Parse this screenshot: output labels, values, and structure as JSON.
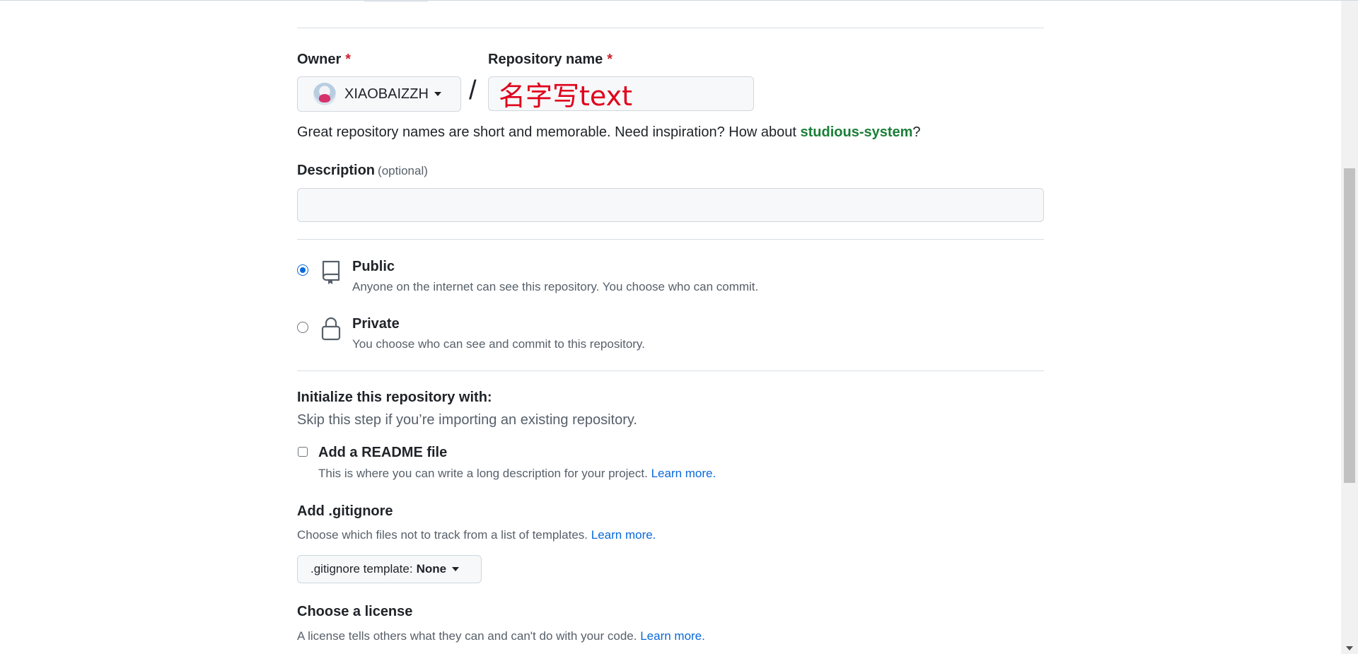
{
  "owner": {
    "label": "Owner",
    "required_mark": "*",
    "value": "XIAOBAIZZH"
  },
  "repository": {
    "label": "Repository name",
    "required_mark": "*",
    "value": "名字写text",
    "separator": "/"
  },
  "hint": {
    "text": "Great repository names are short and memorable. Need inspiration? How about ",
    "suggestion": "studious-system",
    "end": "?"
  },
  "description": {
    "label": "Description",
    "optional": "(optional)",
    "value": ""
  },
  "visibility": {
    "public": {
      "title": "Public",
      "desc": "Anyone on the internet can see this repository. You choose who can commit.",
      "selected": true
    },
    "private": {
      "title": "Private",
      "desc": "You choose who can see and commit to this repository.",
      "selected": false
    }
  },
  "init": {
    "title": "Initialize this repository with:",
    "subtitle": "Skip this step if you’re importing an existing repository.",
    "readme": {
      "label": "Add a README file",
      "desc": "This is where you can write a long description for your project.",
      "learn_more": "Learn more.",
      "checked": false
    }
  },
  "gitignore": {
    "title": "Add .gitignore",
    "desc": "Choose which files not to track from a list of templates.",
    "learn_more": "Learn more.",
    "button_prefix": ".gitignore template:",
    "button_value": "None"
  },
  "license": {
    "title": "Choose a license",
    "desc": "A license tells others what they can and can't do with your code.",
    "learn_more": "Learn more."
  },
  "colors": {
    "accent": "#0969da",
    "required": "#cf222e",
    "suggestion": "#1a7f37",
    "repo_name_text": "#e0001b"
  },
  "icons": {
    "public": "repo-icon",
    "private": "lock-icon",
    "dropdown": "caret-down-icon"
  }
}
